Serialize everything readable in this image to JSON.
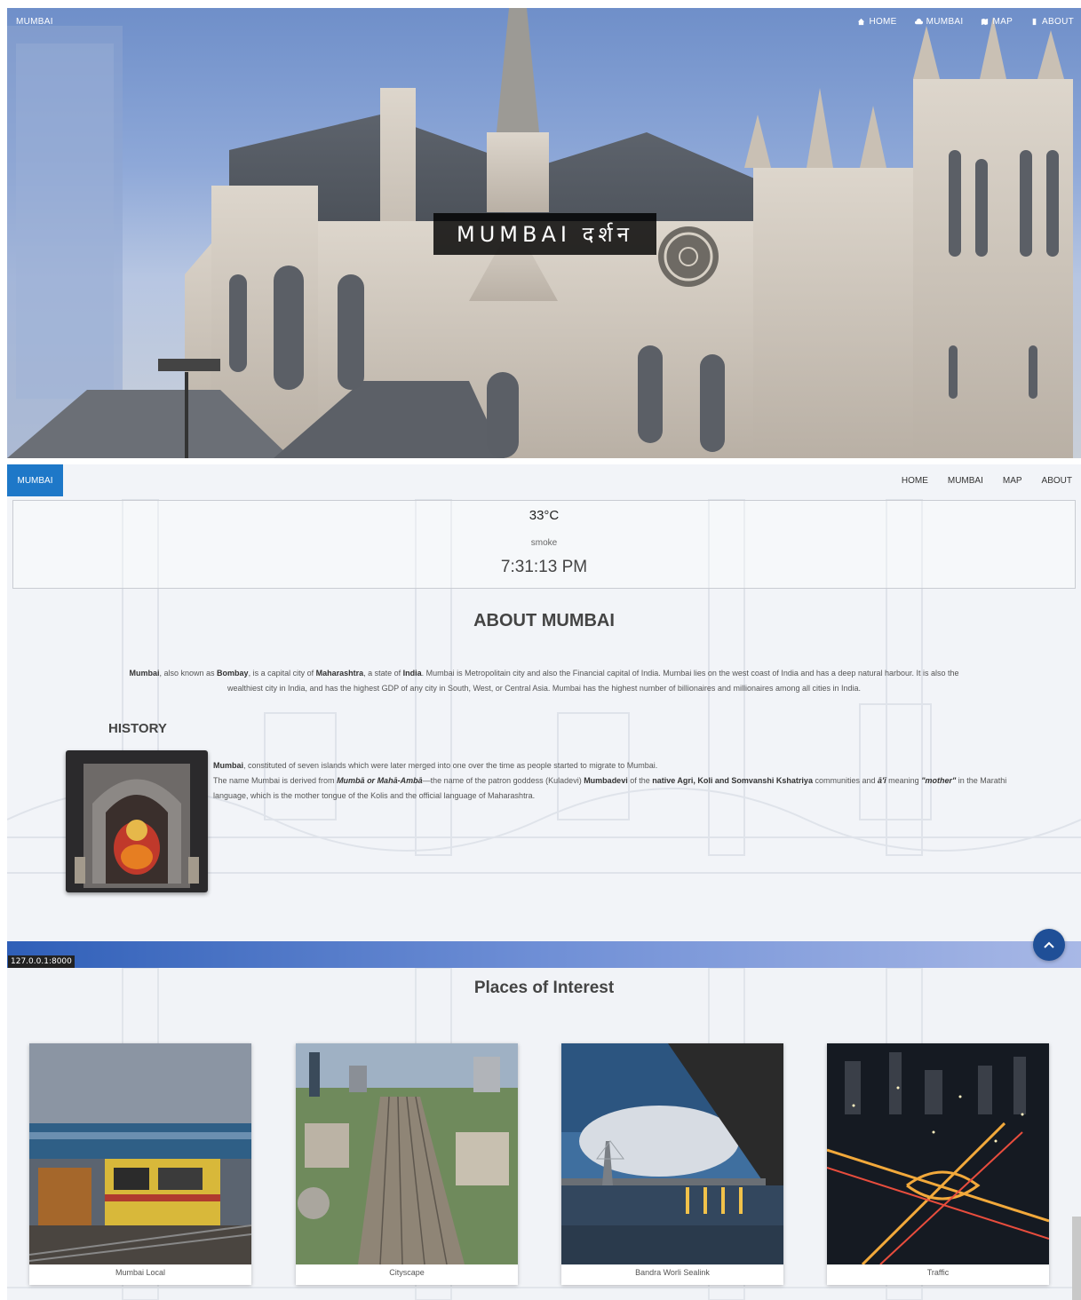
{
  "hero": {
    "brand": "MUMBAI",
    "nav": [
      {
        "label": "HOME",
        "icon": "home-icon"
      },
      {
        "label": "MUMBAI",
        "icon": "cloud-icon"
      },
      {
        "label": "MAP",
        "icon": "map-icon"
      },
      {
        "label": "ABOUT",
        "icon": "info-icon"
      }
    ],
    "title": "MUMBAI दर्शन"
  },
  "navbar": {
    "brand": "MUMBAI",
    "nav": [
      {
        "label": "HOME",
        "icon": "home-icon"
      },
      {
        "label": "MUMBAI",
        "icon": "cloud-icon"
      },
      {
        "label": "MAP",
        "icon": "map-icon"
      },
      {
        "label": "ABOUT",
        "icon": "info-icon"
      }
    ],
    "brand_color": "#1e78c8"
  },
  "weather": {
    "temperature": "33°C",
    "description": "smoke",
    "time": "7:31:13 PM"
  },
  "about": {
    "heading": "ABOUT MUMBAI",
    "p_mumbai": "Mumbai",
    "p_1": ", also known as ",
    "p_bombay": "Bombay",
    "p_2": ", is a capital city of ",
    "p_maharashtra": "Maharashtra",
    "p_3": ", a state of ",
    "p_india": "India",
    "p_4": ". Mumbai is Metropolitain city and also the Financial capital of India. Mumbai lies on the west coast of India and has a deep natural harbour. It is also the wealthiest city in India, and has the highest GDP of any city in South, West, or Central Asia. Mumbai has the highest number of billionaires and millionaires among all cities in India."
  },
  "history": {
    "heading": "HISTORY",
    "l1_bold": "Mumbai",
    "l1_rest": ", constituted of seven islands which were later merged into one over the time as people started to migrate to Mumbai.",
    "l2_a": "The name Mumbai is derived from ",
    "l2_bi": "Mumbā or Mahā-Ambā",
    "l2_b": "—the name of the patron goddess (Kuladevi) ",
    "l2_mumbadevi": "Mumbadevi",
    "l2_c": " of the ",
    "l2_native": "native Agri, Koli and Somvanshi Kshatriya",
    "l2_d": " communities and ",
    "l2_aai": "ā'ī",
    "l2_e": " meaning ",
    "l2_mother": "\"mother\"",
    "l2_f": " in the Marathi language, which is the mother tongue of the Kolis and the official language of Maharashtra."
  },
  "status_url": "127.0.0.1:8000",
  "places": {
    "heading": "Places of Interest",
    "cards": [
      {
        "caption": "Mumbai Local"
      },
      {
        "caption": "Cityscape"
      },
      {
        "caption": "Bandra Worli Sealink"
      },
      {
        "caption": "Traffic"
      }
    ]
  }
}
